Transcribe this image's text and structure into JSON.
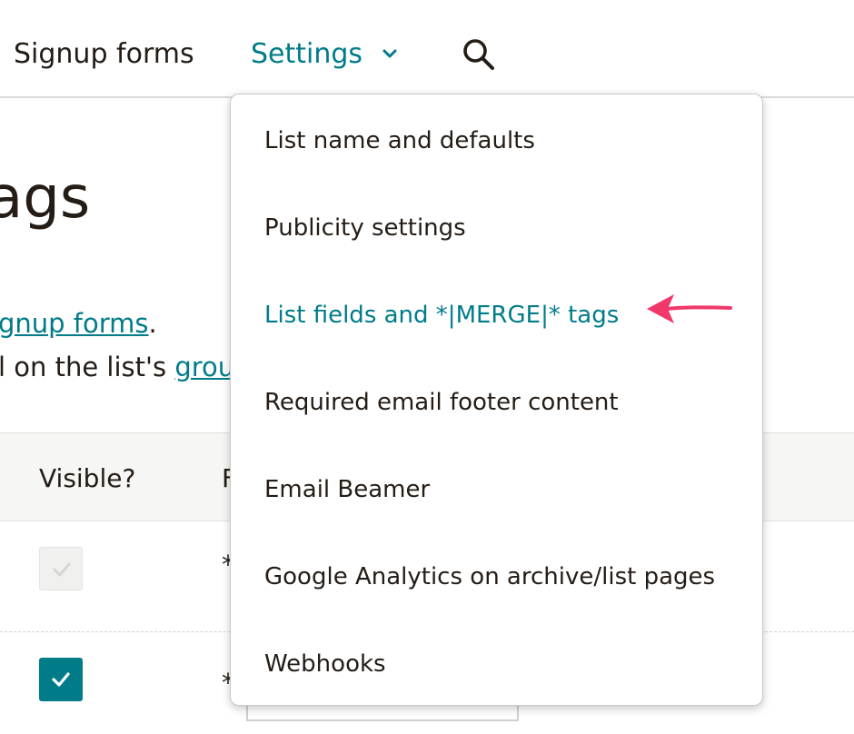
{
  "nav": {
    "signup_forms": "Signup forms",
    "settings": "Settings"
  },
  "page": {
    "title_fragment": "ags",
    "line1_link": "gnup forms",
    "line1_tail": ".",
    "line2_text": "l on the list's ",
    "line2_link": "grou"
  },
  "table": {
    "headers": [
      "Visible?",
      "F"
    ],
    "rows": [
      {
        "visible": true,
        "disabled": true,
        "text": "*"
      },
      {
        "visible": true,
        "disabled": false,
        "text": "*"
      }
    ]
  },
  "dropdown": {
    "items": [
      {
        "label": "List name and defaults"
      },
      {
        "label": "Publicity settings"
      },
      {
        "label": "List fields and *|MERGE|* tags",
        "active": true
      },
      {
        "label": "Required email footer content"
      },
      {
        "label": "Email Beamer"
      },
      {
        "label": "Google Analytics on archive/list pages"
      },
      {
        "label": "Webhooks"
      }
    ]
  },
  "icons": {
    "chevron": "chevron-down-icon",
    "search": "search-icon",
    "check": "check-icon",
    "arrow": "pointer-arrow-annotation"
  },
  "colors": {
    "accent": "#007c89",
    "text": "#241c15",
    "annotation": "#f0386b"
  }
}
